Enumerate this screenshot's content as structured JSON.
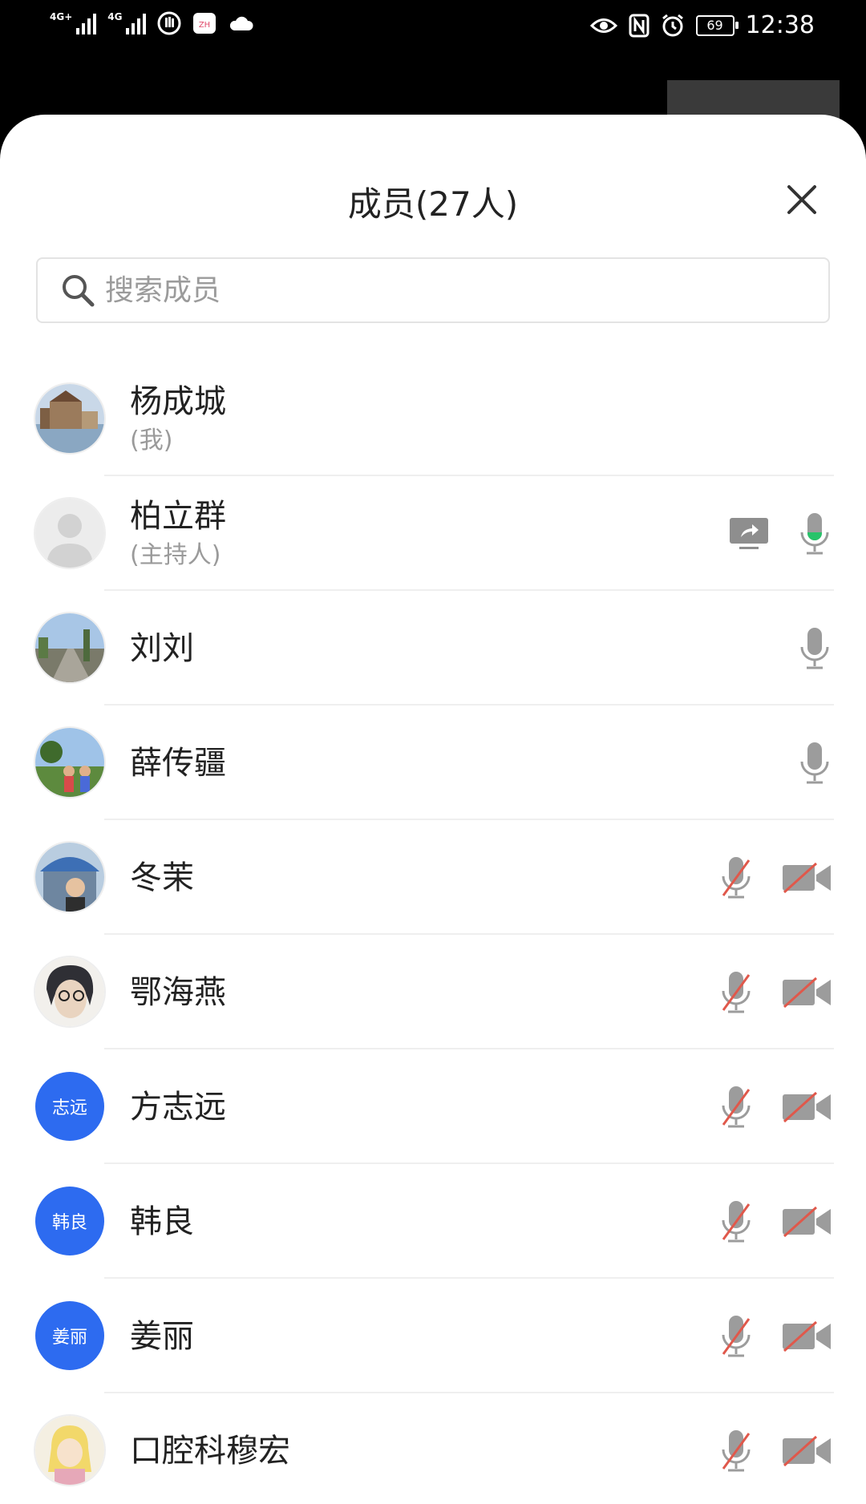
{
  "status_bar": {
    "network1": "4G+",
    "network2": "4G",
    "battery": "69",
    "time": "12:38"
  },
  "panel": {
    "title": "成员(27人)",
    "search_placeholder": "搜索成员"
  },
  "members": [
    {
      "name": "杨成城",
      "sub": "(我)",
      "avatar": "photo-building"
    },
    {
      "name": "柏立群",
      "sub": "(主持人)",
      "avatar": "default-person",
      "share_icon": true,
      "mic": "active"
    },
    {
      "name": "刘刘",
      "sub": "",
      "avatar": "photo-road",
      "mic": "on"
    },
    {
      "name": "薛传疆",
      "sub": "",
      "avatar": "photo-people",
      "mic": "on"
    },
    {
      "name": "冬茉",
      "sub": "",
      "avatar": "photo-umbrella",
      "mic": "muted",
      "camera": "off"
    },
    {
      "name": "鄂海燕",
      "sub": "",
      "avatar": "photo-portrait",
      "mic": "muted",
      "camera": "off"
    },
    {
      "name": "方志远",
      "sub": "",
      "avatar_text": "志远",
      "mic": "muted",
      "camera": "off"
    },
    {
      "name": "韩良",
      "sub": "",
      "avatar_text": "韩良",
      "mic": "muted",
      "camera": "off"
    },
    {
      "name": "姜丽",
      "sub": "",
      "avatar_text": "姜丽",
      "mic": "muted",
      "camera": "off"
    },
    {
      "name": "口腔科穆宏",
      "sub": "",
      "avatar": "photo-cartoon",
      "mic": "muted",
      "camera": "off"
    }
  ],
  "colors": {
    "accent": "#2d6bf0",
    "mic_active": "#27c36a",
    "muted_slash": "#e0584b",
    "icon_gray": "#9c9c9c"
  }
}
